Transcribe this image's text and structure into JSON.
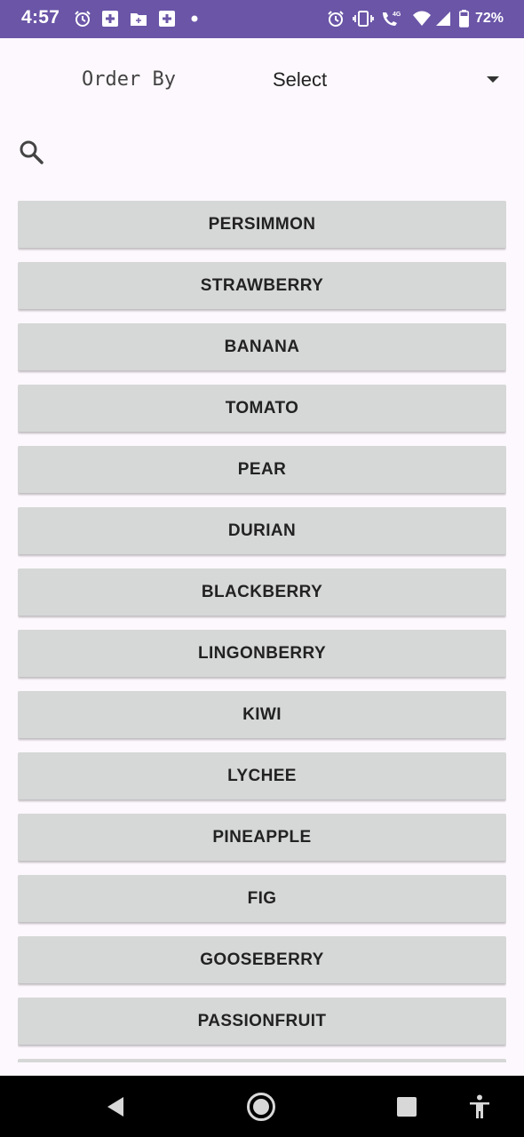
{
  "status_bar": {
    "time": "4:57",
    "battery": "72%",
    "network": "4G",
    "background_color": "#6a55a7",
    "left_icons": [
      "alarm-icon",
      "medical-app-icon",
      "folder-icon",
      "medical-app-icon",
      "dot-icon"
    ],
    "right_icons": [
      "alarm-icon",
      "vibrate-icon",
      "volte-call-icon",
      "wifi-icon",
      "cell-signal-icon",
      "battery-icon"
    ]
  },
  "order": {
    "label": "Order By",
    "selected": "Select"
  },
  "fruits": [
    "PERSIMMON",
    "STRAWBERRY",
    "BANANA",
    "TOMATO",
    "PEAR",
    "DURIAN",
    "BLACKBERRY",
    "LINGONBERRY",
    "KIWI",
    "LYCHEE",
    "PINEAPPLE",
    "FIG",
    "GOOSEBERRY",
    "PASSIONFRUIT",
    ""
  ],
  "nav_bar": {
    "buttons": [
      "back-icon",
      "home-icon",
      "recents-icon",
      "accessibility-icon"
    ]
  }
}
